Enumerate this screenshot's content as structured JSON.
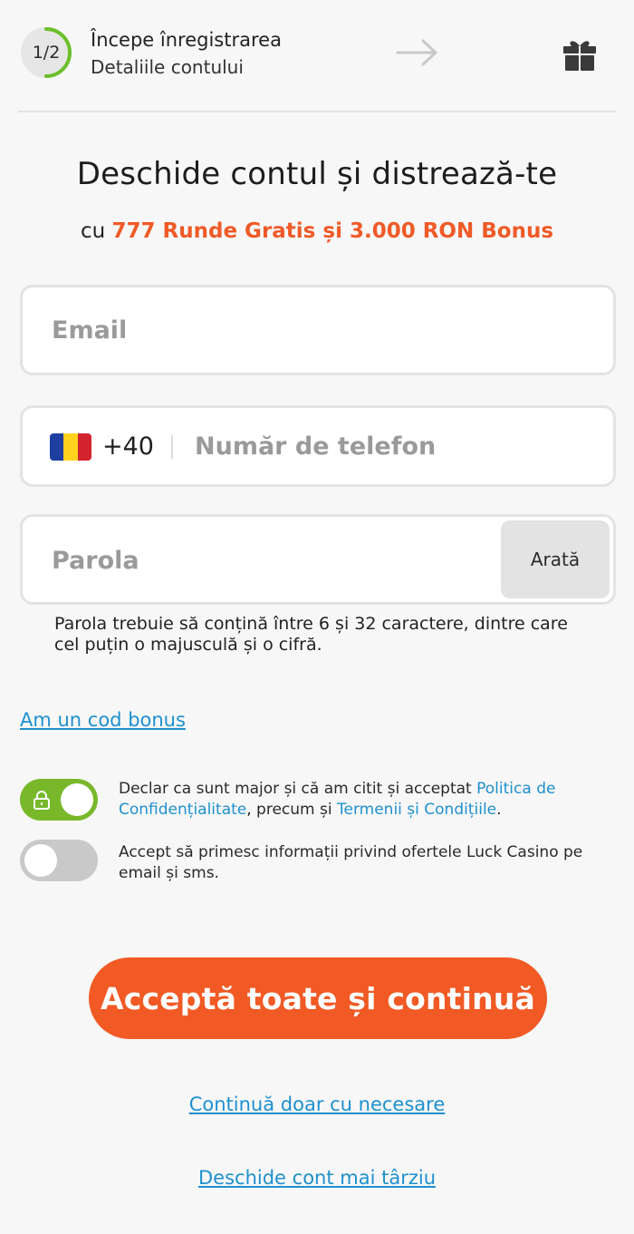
{
  "header": {
    "step_label": "1/2",
    "step_progress": 0.5,
    "title": "Începe înregistrarea",
    "subtitle": "Detaliile contului"
  },
  "colors": {
    "accent": "#f15a24",
    "highlight_text": "#ef5a28",
    "link": "#1e90ce",
    "toggle_on": "#78b82a",
    "toggle_off": "#c9c9c9"
  },
  "promo": {
    "headline": "Deschide contul și distrează-te",
    "prefix": "cu ",
    "highlight": "777 Runde Gratis și 3.000 RON Bonus"
  },
  "form": {
    "email_placeholder": "Email",
    "country_code": "+40",
    "country_flag": "romania-flag",
    "phone_placeholder": "Număr de telefon",
    "password_placeholder": "Parola",
    "show_password_label": "Arată",
    "password_hint": "Parola trebuie să conțină între 6 și 32 caractere, dintre care cel puțin o majusculă și o cifră."
  },
  "bonus_code_link": "Am un cod bonus",
  "consents": [
    {
      "checked": true,
      "text_before": "Declar ca sunt major și că am citit și acceptat ",
      "link1": "Politica de Confidențialitate",
      "text_middle": ", precum și ",
      "link2": "Termenii și Condițiile",
      "text_after": "."
    },
    {
      "checked": false,
      "text": "Accept să primesc informații privind ofertele Luck Casino pe email și sms."
    }
  ],
  "actions": {
    "primary": "Acceptă toate și continuă",
    "secondary": "Continuă doar cu necesare",
    "later": "Deschide cont mai târziu"
  }
}
